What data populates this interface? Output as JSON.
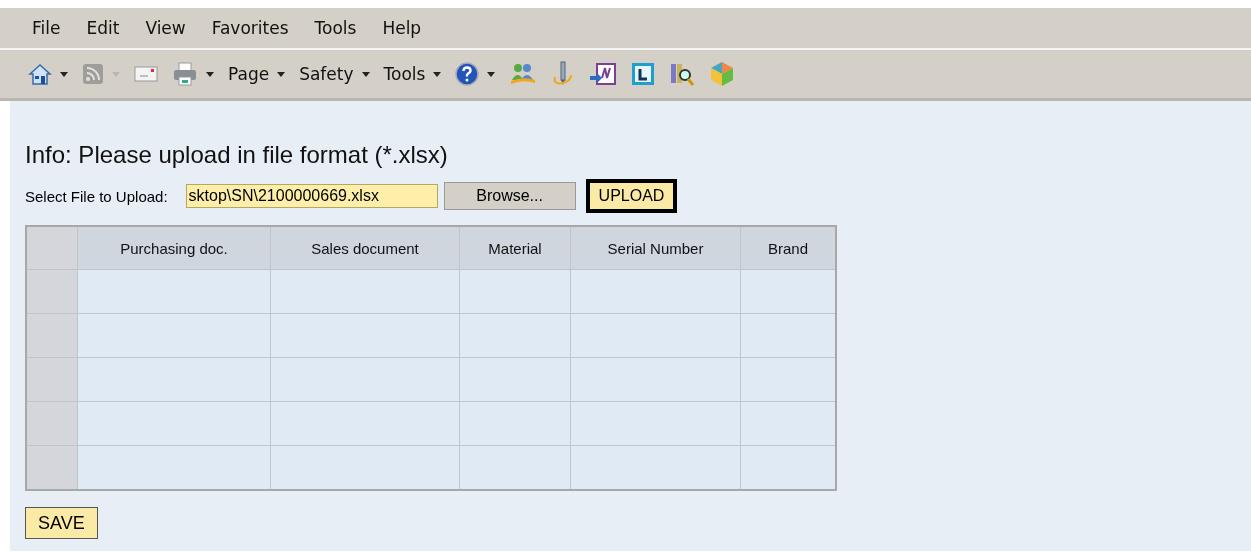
{
  "menu_bar": [
    "File",
    "Edit",
    "View",
    "Favorites",
    "Tools",
    "Help"
  ],
  "toolbar": [
    {
      "kind": "home",
      "dropdown": true,
      "disabled": false
    },
    {
      "kind": "feed",
      "dropdown": true,
      "disabled": true
    },
    {
      "kind": "mail",
      "dropdown": false,
      "disabled": false
    },
    {
      "kind": "print",
      "dropdown": true,
      "disabled": false
    },
    {
      "kind": "menu",
      "label": "Page",
      "dropdown": true,
      "disabled": false
    },
    {
      "kind": "menu",
      "label": "Safety",
      "dropdown": true,
      "disabled": false
    },
    {
      "kind": "menu",
      "label": "Tools",
      "dropdown": true,
      "disabled": false
    },
    {
      "kind": "help",
      "dropdown": true,
      "disabled": false
    },
    {
      "kind": "people",
      "dropdown": false,
      "disabled": false
    },
    {
      "kind": "pen",
      "dropdown": false,
      "disabled": false
    },
    {
      "kind": "note",
      "dropdown": false,
      "disabled": false
    },
    {
      "kind": "tile",
      "dropdown": false,
      "disabled": false
    },
    {
      "kind": "magnifier",
      "dropdown": false,
      "disabled": false
    },
    {
      "kind": "cube",
      "dropdown": false,
      "disabled": false
    }
  ],
  "info": "Info: Please upload in file format (*.xlsx)",
  "file_upload": {
    "label": "Select File to Upload:",
    "value": "sktop\\SN\\2100000669.xlsx",
    "browse": "Browse...",
    "upload": "UPLOAD"
  },
  "table": {
    "columns": [
      "Purchasing doc.",
      "Sales document",
      "Material",
      "Serial Number",
      "Brand"
    ],
    "rows": [
      {
        "selected": false
      },
      {
        "selected": false
      },
      {
        "selected": false
      },
      {
        "selected": false
      },
      {
        "selected": false
      }
    ]
  },
  "save": "SAVE"
}
